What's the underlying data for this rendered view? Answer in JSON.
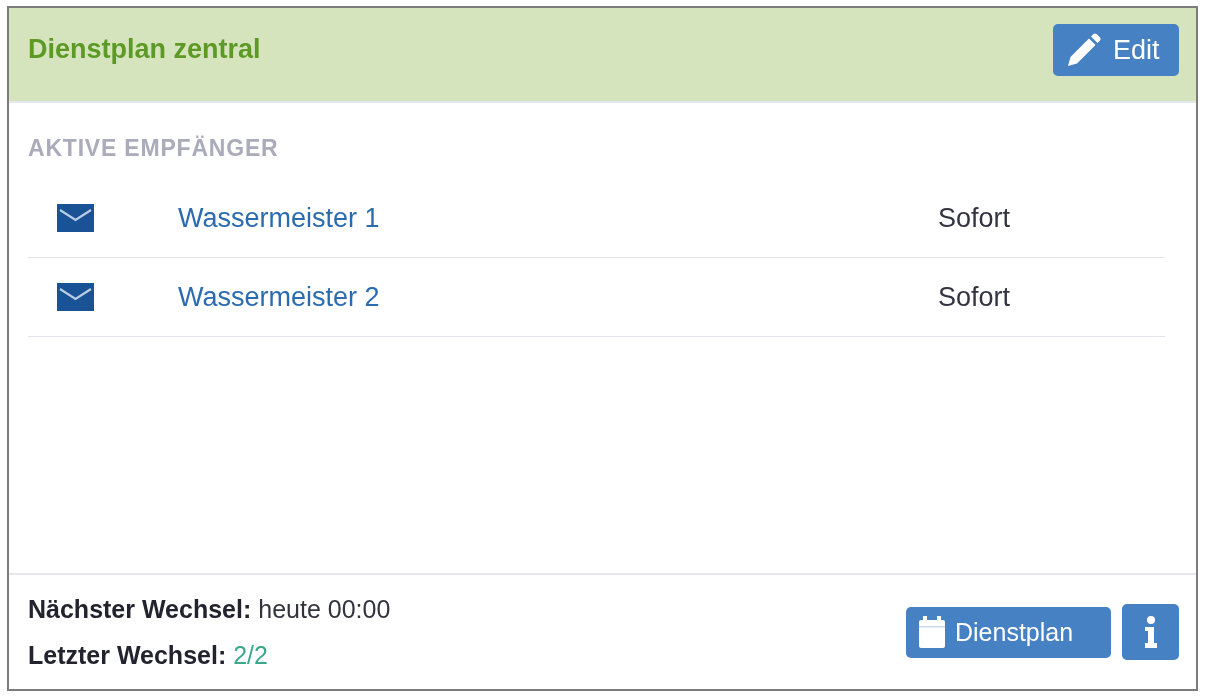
{
  "panel": {
    "title": "Dienstplan zentral",
    "edit_button": {
      "label": "Edit"
    }
  },
  "section_label": "AKTIVE EMPFÄNGER",
  "recipients": [
    {
      "name": "Wassermeister 1",
      "delay": "Sofort"
    },
    {
      "name": "Wassermeister 2",
      "delay": "Sofort"
    }
  ],
  "footer": {
    "info": [
      {
        "label": "Nächster Wechsel:",
        "value": "heute 00:00",
        "kind": "text"
      },
      {
        "label": "Letzter Wechsel:",
        "value": "2/2",
        "kind": "link"
      }
    ],
    "buttons": [
      {
        "kind": "schedule",
        "label": "Dienstplan"
      },
      {
        "kind": "info"
      }
    ]
  }
}
